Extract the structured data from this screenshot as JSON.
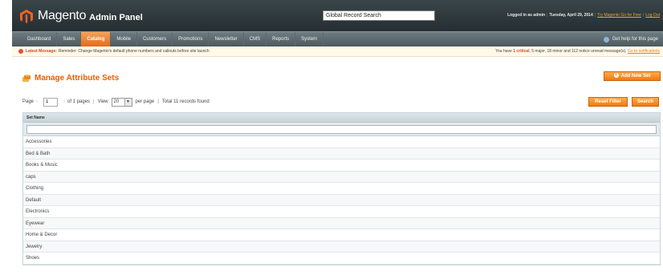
{
  "header": {
    "logo_text": "Magento",
    "logo_sub": "Admin Panel",
    "global_search_placeholder": "Global Record Search",
    "logged_in": "Logged in as admin",
    "date": "Tuesday, April 29, 2014",
    "try_link": "Try Magento Go for Free",
    "logout": "Log Out",
    "separator": "|"
  },
  "nav": {
    "items": [
      "Dashboard",
      "Sales",
      "Catalog",
      "Mobile",
      "Customers",
      "Promotions",
      "Newsletter",
      "CMS",
      "Reports",
      "System"
    ],
    "active": "Catalog",
    "help": "Get help for this page"
  },
  "message": {
    "label": "Latest Message:",
    "text": "Reminder: Change Magento's default phone numbers and callouts before site launch",
    "summary_pre": "You have",
    "critical": "1 critical",
    "summary_post": ", 5 major, 18 minor and 112 notice unread message(s).",
    "link": "Go to notifications"
  },
  "page": {
    "title": "Manage Attribute Sets",
    "add_button": "Add New Set",
    "reset_button": "Reset Filter",
    "search_button": "Search"
  },
  "pager": {
    "page_label": "Page",
    "page_value": "1",
    "of_pages": "of 1 pages",
    "view_label": "View",
    "per_page_value": "20",
    "per_page_label": "per page",
    "total": "Total 11 records found",
    "separator": "|"
  },
  "grid": {
    "column": "Set Name",
    "rows": [
      "Accessories",
      "Bed & Bath",
      "Books & Music",
      "caps",
      "Clothing",
      "Default",
      "Electronics",
      "Eyewear",
      "Home & Decor",
      "Jewelry",
      "Shoes"
    ]
  },
  "colors": {
    "accent": "#eb5e00",
    "header_bg": "#2a3437",
    "nav_active": "#e26b1c"
  }
}
